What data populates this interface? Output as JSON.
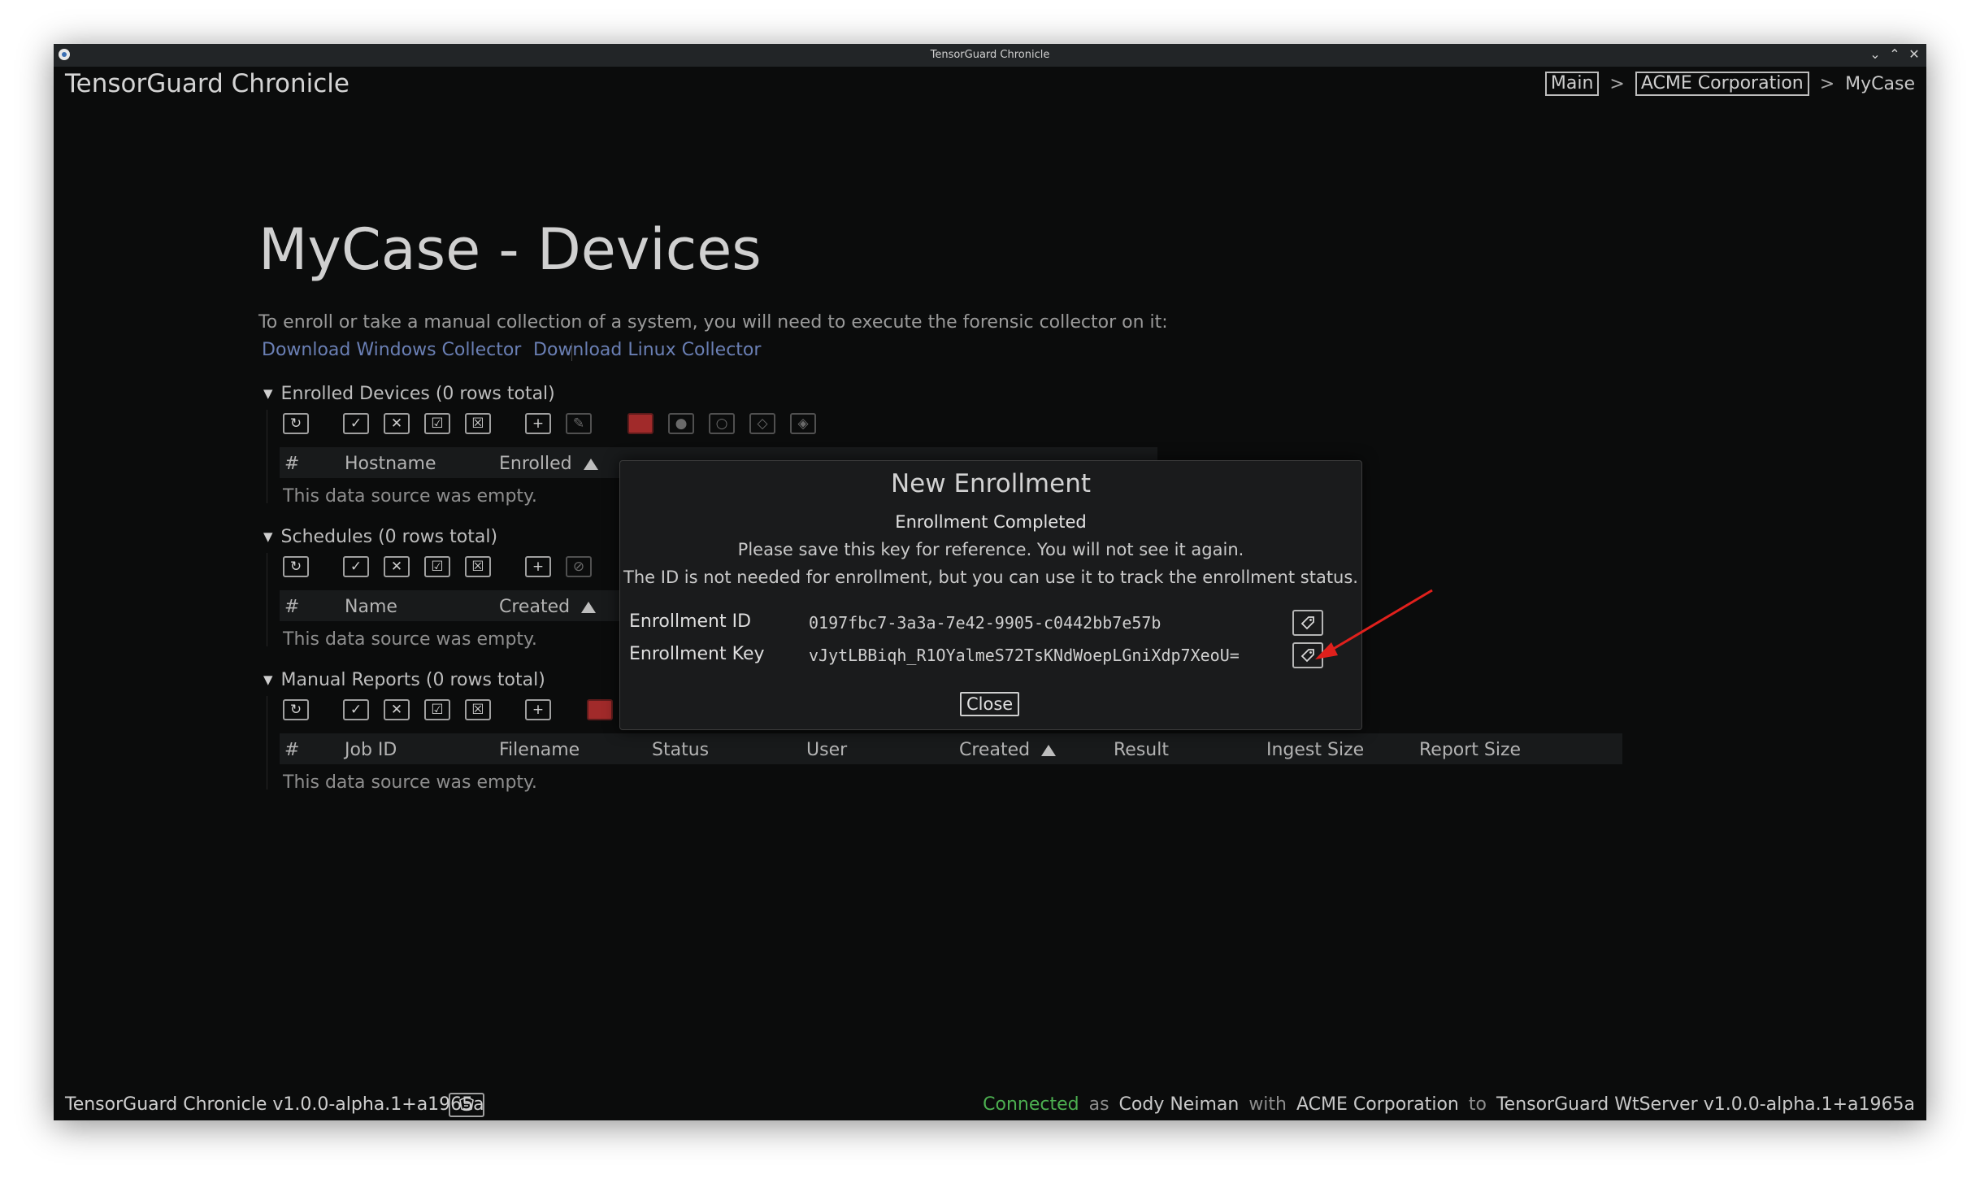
{
  "window": {
    "title": "TensorGuard Chronicle"
  },
  "header": {
    "app_name": "TensorGuard Chronicle",
    "breadcrumb": {
      "main": "Main",
      "org": "ACME Corporation",
      "current": "MyCase",
      "separator": ">"
    }
  },
  "page": {
    "title": "MyCase - Devices",
    "intro": "To enroll or take a manual collection of a system, you will need to execute the forensic collector on it:",
    "download_windows": "Download Windows Collector",
    "download_linux": "Download Linux Collector"
  },
  "sections": {
    "enrolled": {
      "header": "Enrolled Devices (0 rows total)",
      "columns": [
        "#",
        "Hostname",
        "Enrolled"
      ],
      "empty": "This data source was empty."
    },
    "schedules": {
      "header": "Schedules (0 rows total)",
      "columns": [
        "#",
        "Name",
        "Created"
      ],
      "empty": "This data source was empty."
    },
    "reports": {
      "header": "Manual Reports (0 rows total)",
      "columns": [
        "#",
        "Job ID",
        "Filename",
        "Status",
        "User",
        "Created",
        "Result",
        "Ingest Size",
        "Report Size"
      ],
      "empty": "This data source was empty."
    }
  },
  "modal": {
    "title": "New Enrollment",
    "subtitle": "Enrollment Completed",
    "line1": "Please save this key for reference. You will not see it again.",
    "line2": "The ID is not needed for enrollment, but you can use it to track the enrollment status.",
    "id_label": "Enrollment ID",
    "id_value": "0197fbc7-3a3a-7e42-9905-c0442bb7e57b",
    "key_label": "Enrollment Key",
    "key_value": "vJytLBBiqh_R1OYalmeS72TsKNdWoepLGniXdp7XeoU=",
    "close_label": "Close"
  },
  "statusbar": {
    "version": "TensorGuard Chronicle v1.0.0-alpha.1+a1965a",
    "connected": "Connected",
    "as": "as",
    "user": "Cody Neiman",
    "with": "with",
    "org": "ACME Corporation",
    "to": "to",
    "server": "TensorGuard WtServer v1.0.0-alpha.1+a1965a"
  },
  "colors": {
    "accent_link": "#6a7fb4",
    "connected": "#4caf50",
    "danger": "#a12a2a",
    "annotation": "#e0201c"
  }
}
